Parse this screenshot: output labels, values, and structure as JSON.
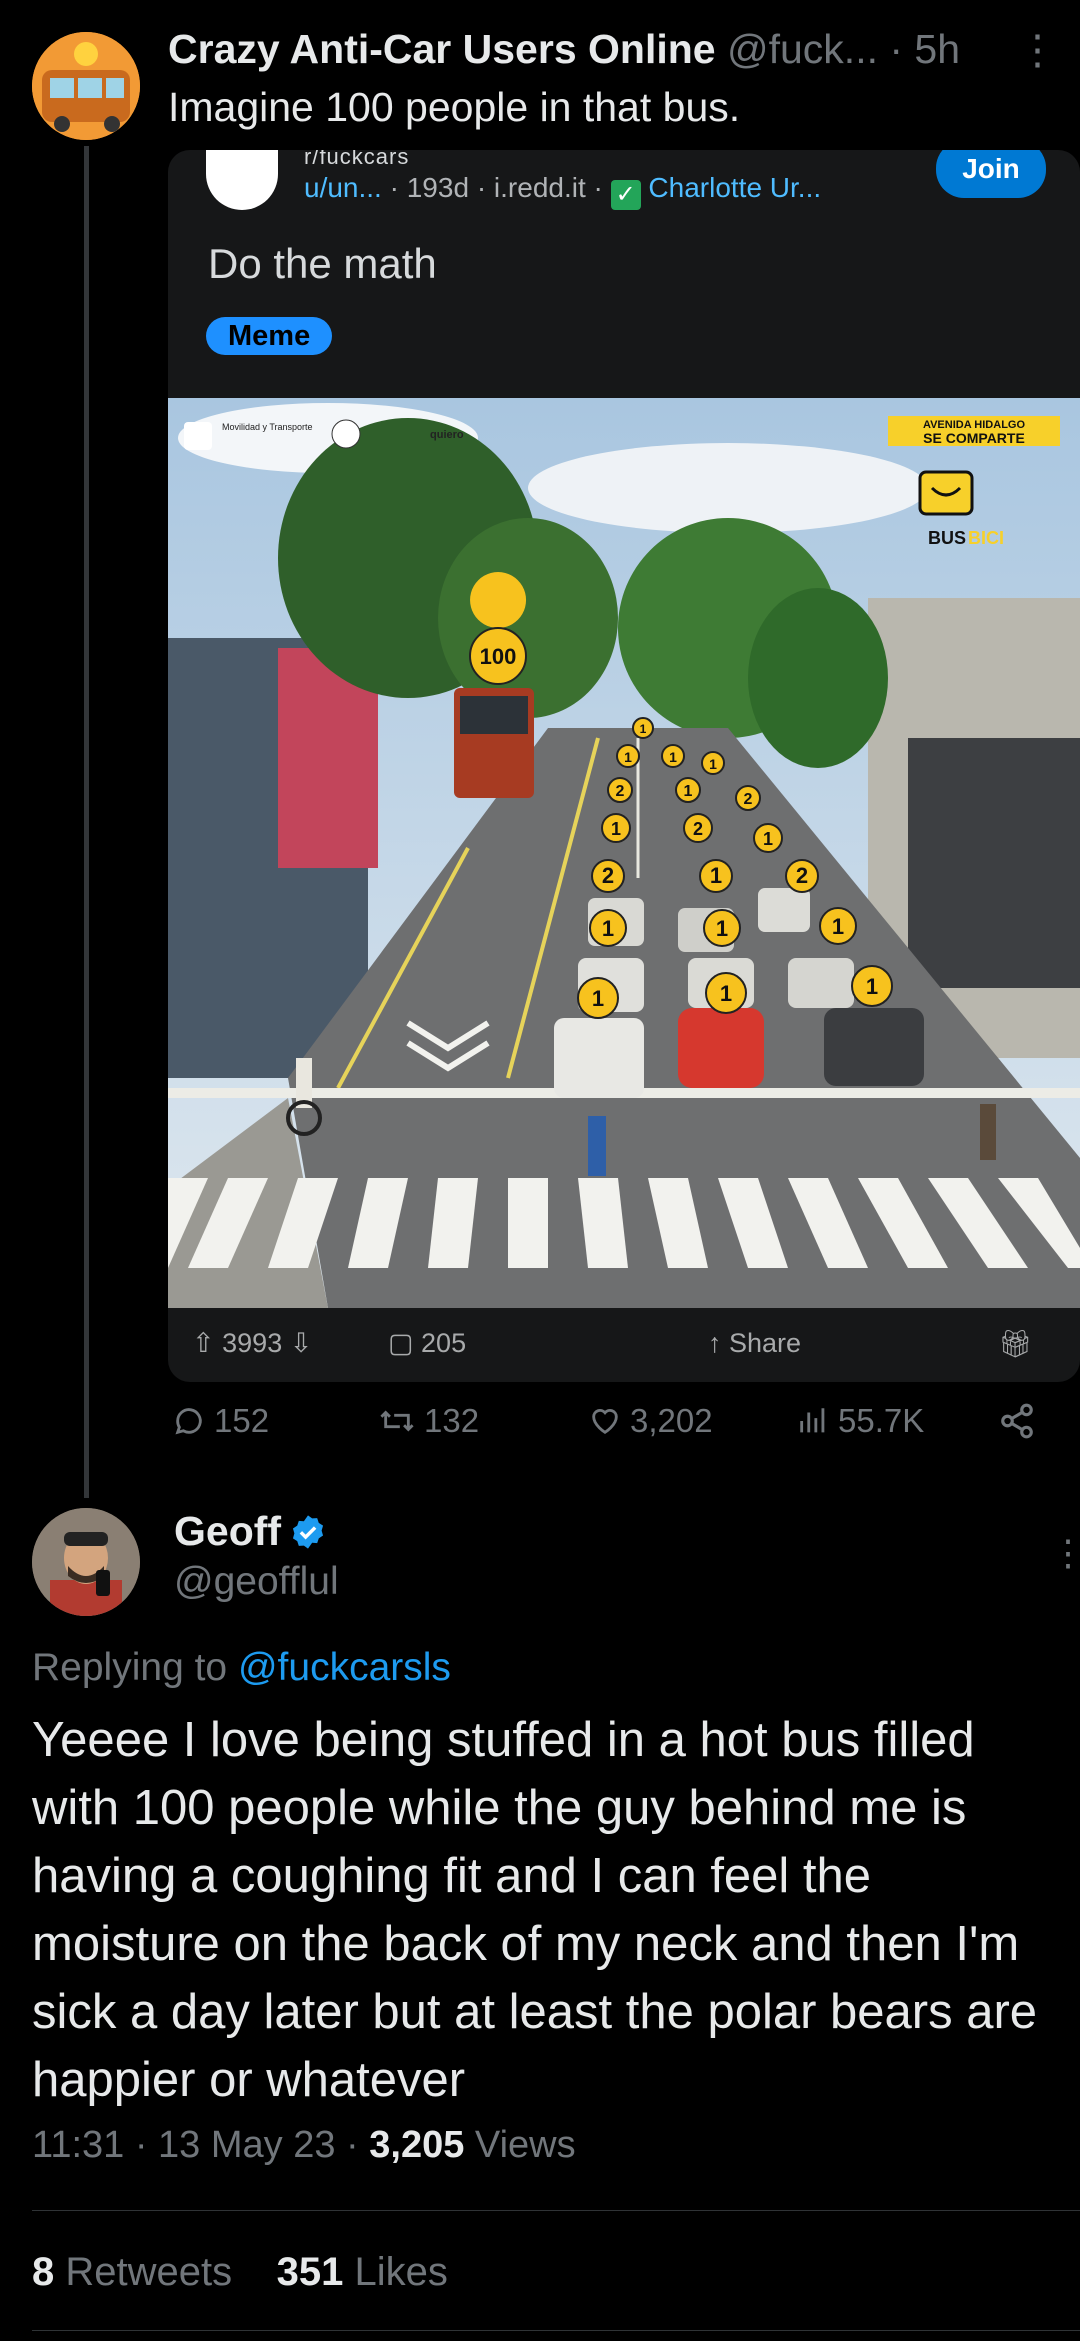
{
  "parent_tweet": {
    "display_name": "Crazy Anti-Car Users Online",
    "handle": "@fuck...",
    "time": "· 5h",
    "more": "⋮",
    "text": "Imagine 100 people in that bus."
  },
  "reddit_card": {
    "subreddit": "r/fuckcars",
    "meta_user": "u/un...",
    "meta_age": "· 193d",
    "meta_domain": "· i.redd.it ·",
    "meta_flair_user": "Charlotte Ur...",
    "join_label": "Join",
    "title": "Do the math",
    "post_flair": "Meme",
    "image": {
      "logo_left_1": "Movilidad y Transporte",
      "logo_left_3": "quiero",
      "badge_line1": "AVENIDA HIDALGO",
      "badge_line2": "SE COMPARTE",
      "badge_brand_1": "BUS",
      "badge_brand_2": "BICI",
      "bus_marker": "100",
      "car_markers": [
        "1",
        "1",
        "2",
        "1",
        "2",
        "1",
        "1",
        "1",
        "1",
        "1",
        "1",
        "2",
        "1",
        "2",
        "1",
        "1",
        "1",
        "1",
        "1"
      ]
    },
    "upvotes": "3993",
    "comments": "205",
    "share_label": "Share"
  },
  "engagement": {
    "replies": "152",
    "retweets": "132",
    "likes": "3,202",
    "views": "55.7K"
  },
  "reply_tweet": {
    "display_name": "Geoff",
    "handle": "@geofflul",
    "more": "⋮",
    "replying_prefix": "Replying to",
    "replying_to": "@fuckcarsls",
    "text": "Yeeee I love being stuffed in a hot bus filled with 100 people while the guy behind me is having a coughing fit and I can feel the moisture on the back of my neck and then I'm sick a day later but at least the polar bears are happier or whatever",
    "time": "11:31 · 13 May 23 ·",
    "views_count": "3,205",
    "views_label": "Views",
    "retweets_count": "8",
    "retweets_label": "Retweets",
    "likes_count": "351",
    "likes_label": "Likes"
  },
  "colors": {
    "background": "#000000",
    "text": "#e7e9ea",
    "muted": "#71767b",
    "link": "#1d9bf0",
    "reddit_join": "#0079d3",
    "verified": "#1d9bf0"
  }
}
